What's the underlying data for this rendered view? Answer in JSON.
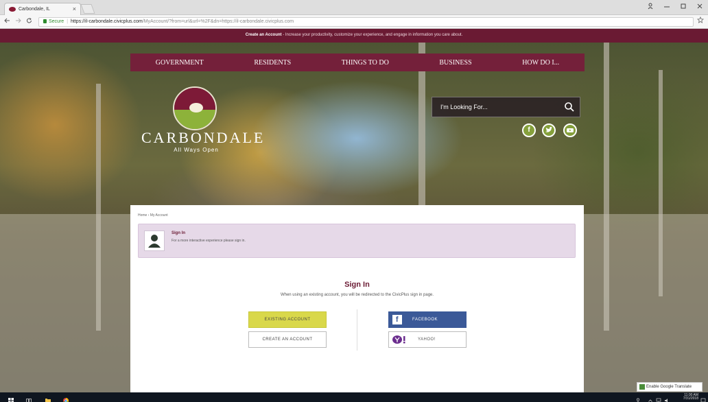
{
  "browser": {
    "tab_title": "Carbondale, IL",
    "tab_close": "×",
    "url_secure_label": "Secure",
    "url_host": "https://il-carbondale.civicplus.com",
    "url_path": "/MyAccount/?from=url&url=%2F&dn=https://il-carbondale.civicplus.com"
  },
  "banner": {
    "link_text": "Create an Account",
    "text": " - Increase your productivity, customize your experience, and engage in information you care about."
  },
  "nav": {
    "items": [
      "GOVERNMENT",
      "RESIDENTS",
      "THINGS TO DO",
      "BUSINESS",
      "HOW DO I..."
    ]
  },
  "logo": {
    "name": "CARBONDALE",
    "tagline": "All Ways Open"
  },
  "search": {
    "placeholder": "I'm Looking For..."
  },
  "social": {
    "icons": [
      "facebook-icon",
      "twitter-icon",
      "youtube-icon"
    ]
  },
  "content": {
    "breadcrumb": "Home › My Account",
    "signin_banner_title": "Sign In",
    "signin_banner_text": "For a more interactive experience please sign in.",
    "heading": "Sign In",
    "subtext": "When using an existing account, you will be redirected to the CivicPlus sign in page.",
    "existing_account": "EXISTING ACCOUNT",
    "create_account": "CREATE AN ACCOUNT",
    "facebook": "FACEBOOK",
    "yahoo": "YAHOO!"
  },
  "translate": {
    "label": "Enable Google Translate"
  },
  "taskbar": {
    "time": "11:00 AM",
    "date": "7/31/2018"
  },
  "colors": {
    "brand": "#6a1a33",
    "nav": "#74203a",
    "accent_green": "#8db23a",
    "existing_button": "#d9d84a",
    "facebook": "#3b5998"
  }
}
